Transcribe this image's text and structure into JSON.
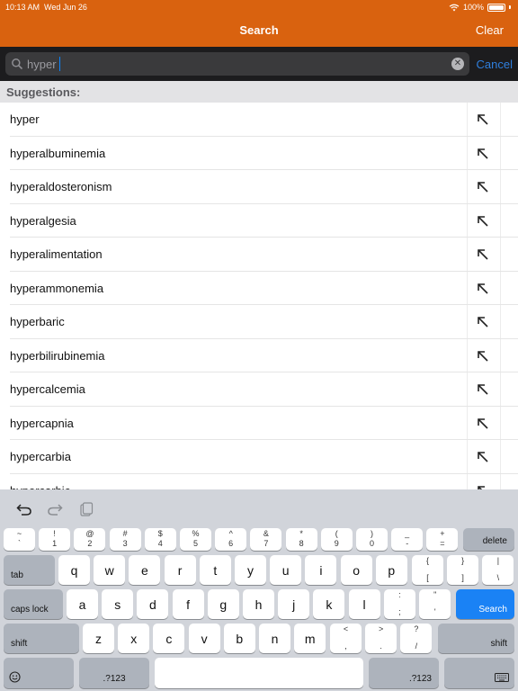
{
  "status": {
    "time": "10:13 AM",
    "date": "Wed Jun 26",
    "battery": "100%"
  },
  "nav": {
    "title": "Search",
    "clear_label": "Clear"
  },
  "search": {
    "value": "hyper",
    "cancel_label": "Cancel"
  },
  "suggestions": {
    "header": "Suggestions:",
    "items": [
      "hyper",
      "hyperalbuminemia",
      "hyperaldosteronism",
      "hyperalgesia",
      "hyperalimentation",
      "hyperammonemia",
      "hyperbaric",
      "hyperbilirubinemia",
      "hypercalcemia",
      "hypercapnia",
      "hypercarbia",
      "hypercarbic"
    ]
  },
  "keyboard": {
    "number_row": [
      {
        "top": "~",
        "bot": "`"
      },
      {
        "top": "!",
        "bot": "1"
      },
      {
        "top": "@",
        "bot": "2"
      },
      {
        "top": "#",
        "bot": "3"
      },
      {
        "top": "$",
        "bot": "4"
      },
      {
        "top": "%",
        "bot": "5"
      },
      {
        "top": "^",
        "bot": "6"
      },
      {
        "top": "&",
        "bot": "7"
      },
      {
        "top": "*",
        "bot": "8"
      },
      {
        "top": "(",
        "bot": "9"
      },
      {
        "top": ")",
        "bot": "0"
      },
      {
        "top": "_",
        "bot": "-"
      },
      {
        "top": "+",
        "bot": "="
      }
    ],
    "delete": "delete",
    "tab": "tab",
    "row1": [
      "q",
      "w",
      "e",
      "r",
      "t",
      "y",
      "u",
      "i",
      "o",
      "p"
    ],
    "row1_sym": [
      {
        "top": "{",
        "bot": "["
      },
      {
        "top": "}",
        "bot": "]"
      },
      {
        "top": "|",
        "bot": "\\"
      }
    ],
    "caps_lock": "caps lock",
    "row2": [
      "a",
      "s",
      "d",
      "f",
      "g",
      "h",
      "j",
      "k",
      "l"
    ],
    "row2_sym": [
      {
        "top": ":",
        "bot": ";"
      },
      {
        "top": "\"",
        "bot": "'"
      }
    ],
    "search_key": "Search",
    "shift": "shift",
    "row3": [
      "z",
      "x",
      "c",
      "v",
      "b",
      "n",
      "m"
    ],
    "row3_sym": [
      {
        "top": "<",
        "bot": ","
      },
      {
        "top": ">",
        "bot": "."
      },
      {
        "top": "?",
        "bot": "/"
      }
    ],
    "numeric": ".?123"
  },
  "colors": {
    "header": "#d9620f",
    "accent": "#2f7fde",
    "search_key": "#1a82f5"
  }
}
